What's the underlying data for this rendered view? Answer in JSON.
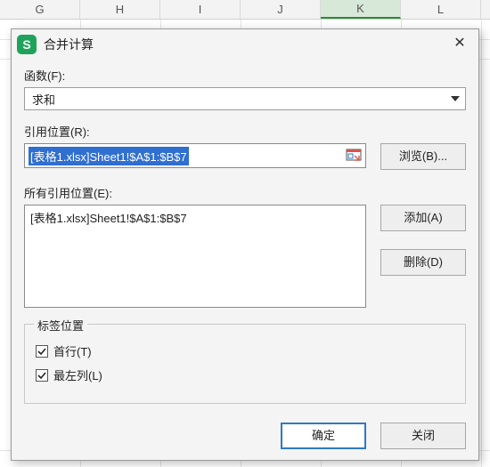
{
  "columns": [
    "G",
    "H",
    "I",
    "J",
    "K",
    "L"
  ],
  "selectedColumnIndex": 4,
  "dialog": {
    "title": "合并计算",
    "function_label": "函数(F):",
    "function_value": "求和",
    "reference_label": "引用位置(R):",
    "reference_value": "[表格1.xlsx]Sheet1!$A$1:$B$7",
    "browse_btn": "浏览(B)...",
    "all_refs_label": "所有引用位置(E):",
    "all_refs_items": [
      "[表格1.xlsx]Sheet1!$A$1:$B$7"
    ],
    "add_btn": "添加(A)",
    "delete_btn": "删除(D)",
    "labels_group_title": "标签位置",
    "top_row_label": "首行(T)",
    "top_row_checked": true,
    "left_col_label": "最左列(L)",
    "left_col_checked": true,
    "ok_btn": "确定",
    "close_btn": "关闭"
  }
}
